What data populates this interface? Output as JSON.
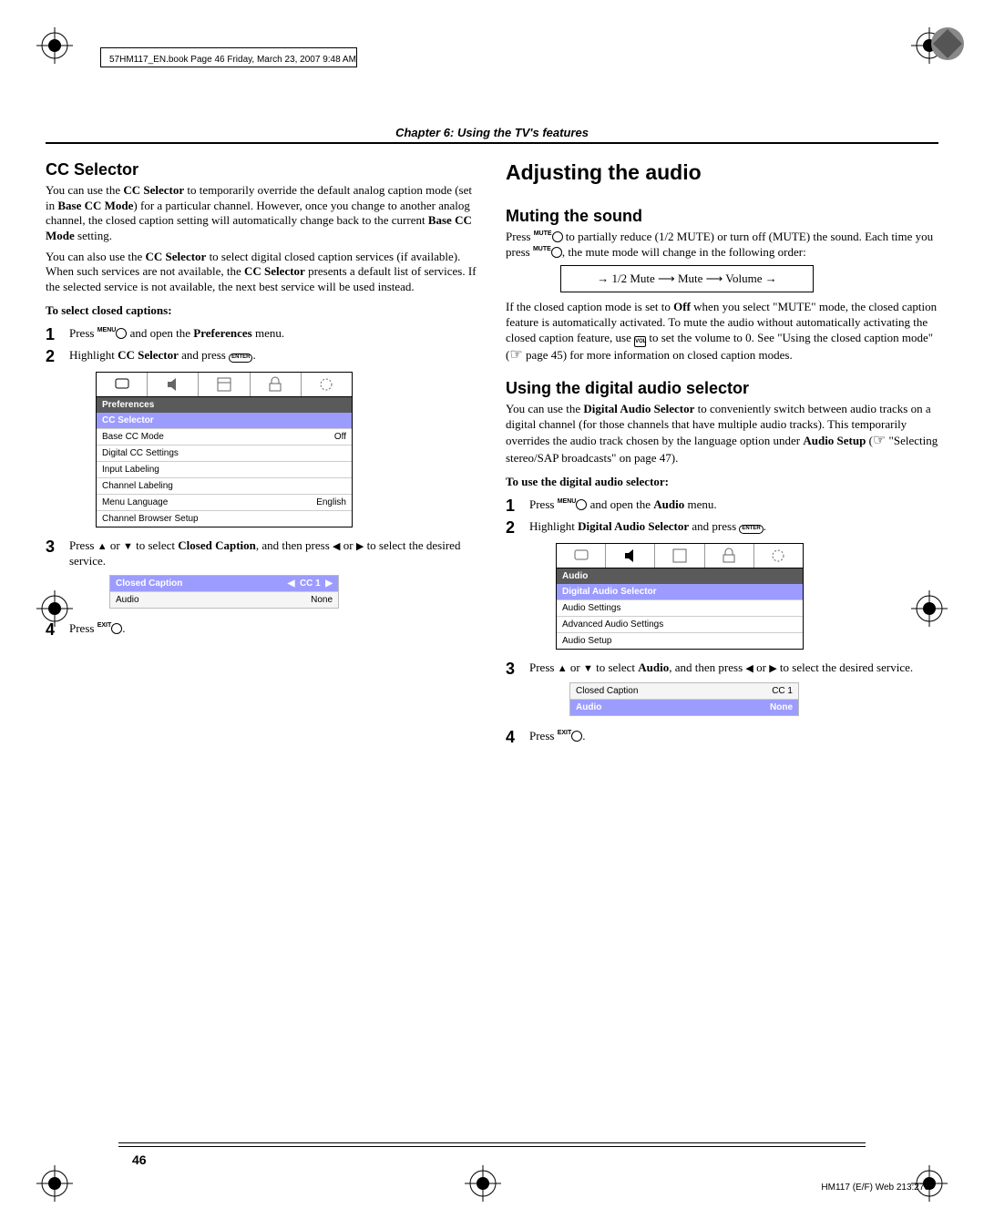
{
  "header": {
    "book_line": "57HM117_EN.book  Page 46  Friday, March 23, 2007  9:48 AM",
    "chapter": "Chapter 6: Using the TV's features"
  },
  "left": {
    "h2": "CC Selector",
    "para1_a": "You can use the ",
    "para1_b": "CC Selector",
    "para1_c": " to temporarily override the default analog caption mode (set in ",
    "para1_d": "Base CC Mode",
    "para1_e": ") for a particular channel. However, once you change to another analog channel, the closed caption setting will automatically change back to the current ",
    "para1_f": "Base CC Mode",
    "para1_g": " setting.",
    "para2_a": "You can also use the ",
    "para2_b": "CC Selector",
    "para2_c": " to select digital closed caption services (if available). When such services are not available, the ",
    "para2_d": "CC Selector",
    "para2_e": " presents a default list of services. If the selected service is not available, the next best service will be used instead.",
    "sub1": "To select closed captions:",
    "s1_a": "Press ",
    "s1_btn": "MENU",
    "s1_b": " and open the ",
    "s1_c": "Preferences",
    "s1_d": " menu.",
    "s2_a": "Highlight ",
    "s2_b": "CC Selector",
    "s2_c": " and press ",
    "s2_enter": "ENTER",
    "menu": {
      "title": "Preferences",
      "sel": "CC Selector",
      "r1a": "Base CC Mode",
      "r1b": "Off",
      "r2": "Digital CC Settings",
      "r3": "Input Labeling",
      "r4": "Channel Labeling",
      "r5a": "Menu Language",
      "r5b": "English",
      "r6": "Channel Browser Setup"
    },
    "s3_a": "Press ",
    "s3_b": " or ",
    "s3_c": " to select ",
    "s3_d": "Closed Caption",
    "s3_e": ", and then press ",
    "s3_f": " or ",
    "s3_g": " to select the desired service.",
    "opt": {
      "r1a": "Closed Caption",
      "r1b": "CC 1",
      "r2a": "Audio",
      "r2b": "None"
    },
    "s4_a": "Press ",
    "s4_btn": "EXIT"
  },
  "right": {
    "h1": "Adjusting the audio",
    "h2a": "Muting the sound",
    "p1_a": "Press ",
    "p1_btn": "MUTE",
    "p1_b": " to partially reduce (1/2 MUTE) or turn off (MUTE) the sound. Each time you press ",
    "p1_c": ", the mute mode will change in the following order:",
    "flow_1": "1/2 Mute",
    "flow_2": "Mute",
    "flow_3": "Volume",
    "p2_a": "If the closed caption mode is set to ",
    "p2_b": "Off",
    "p2_c": " when you select \"MUTE\" mode, the closed caption feature is automatically activated. To mute the audio without automatically activating the closed caption feature, use ",
    "p2_vol": "VOL",
    "p2_d": " to set the volume to 0. See \"Using the closed caption mode\" (",
    "p2_e": " page 45) for more information on closed caption modes.",
    "h2b": "Using the digital audio selector",
    "p3_a": "You can use the ",
    "p3_b": "Digital Audio Selector",
    "p3_c": " to conveniently switch between audio tracks on a digital channel (for those channels that have multiple audio tracks). This temporarily overrides the audio track chosen by the language option under ",
    "p3_d": "Audio Setup",
    "p3_e": " (",
    "p3_f": " \"Selecting stereo/SAP broadcasts\" on page 47).",
    "sub1": "To use the digital audio selector:",
    "s1_a": "Press ",
    "s1_btn": "MENU",
    "s1_b": " and open the ",
    "s1_c": "Audio",
    "s1_d": " menu.",
    "s2_a": "Highlight ",
    "s2_b": "Digital Audio Selector",
    "s2_c": " and press ",
    "s2_enter": "ENTER",
    "menu": {
      "title": "Audio",
      "sel": "Digital Audio Selector",
      "r1": "Audio Settings",
      "r2": "Advanced Audio Settings",
      "r3": "Audio Setup"
    },
    "s3_a": "Press ",
    "s3_b": " or ",
    "s3_c": " to select ",
    "s3_d": "Audio",
    "s3_e": ", and then press ",
    "s3_f": " or ",
    "s3_g": " to select the desired service.",
    "opt": {
      "r1a": "Closed Caption",
      "r1b": "CC 1",
      "r2a": "Audio",
      "r2b": "None"
    },
    "s4_a": "Press ",
    "s4_btn": "EXIT"
  },
  "footer": {
    "page": "46",
    "right": "HM117 (E/F) Web 213:276"
  }
}
